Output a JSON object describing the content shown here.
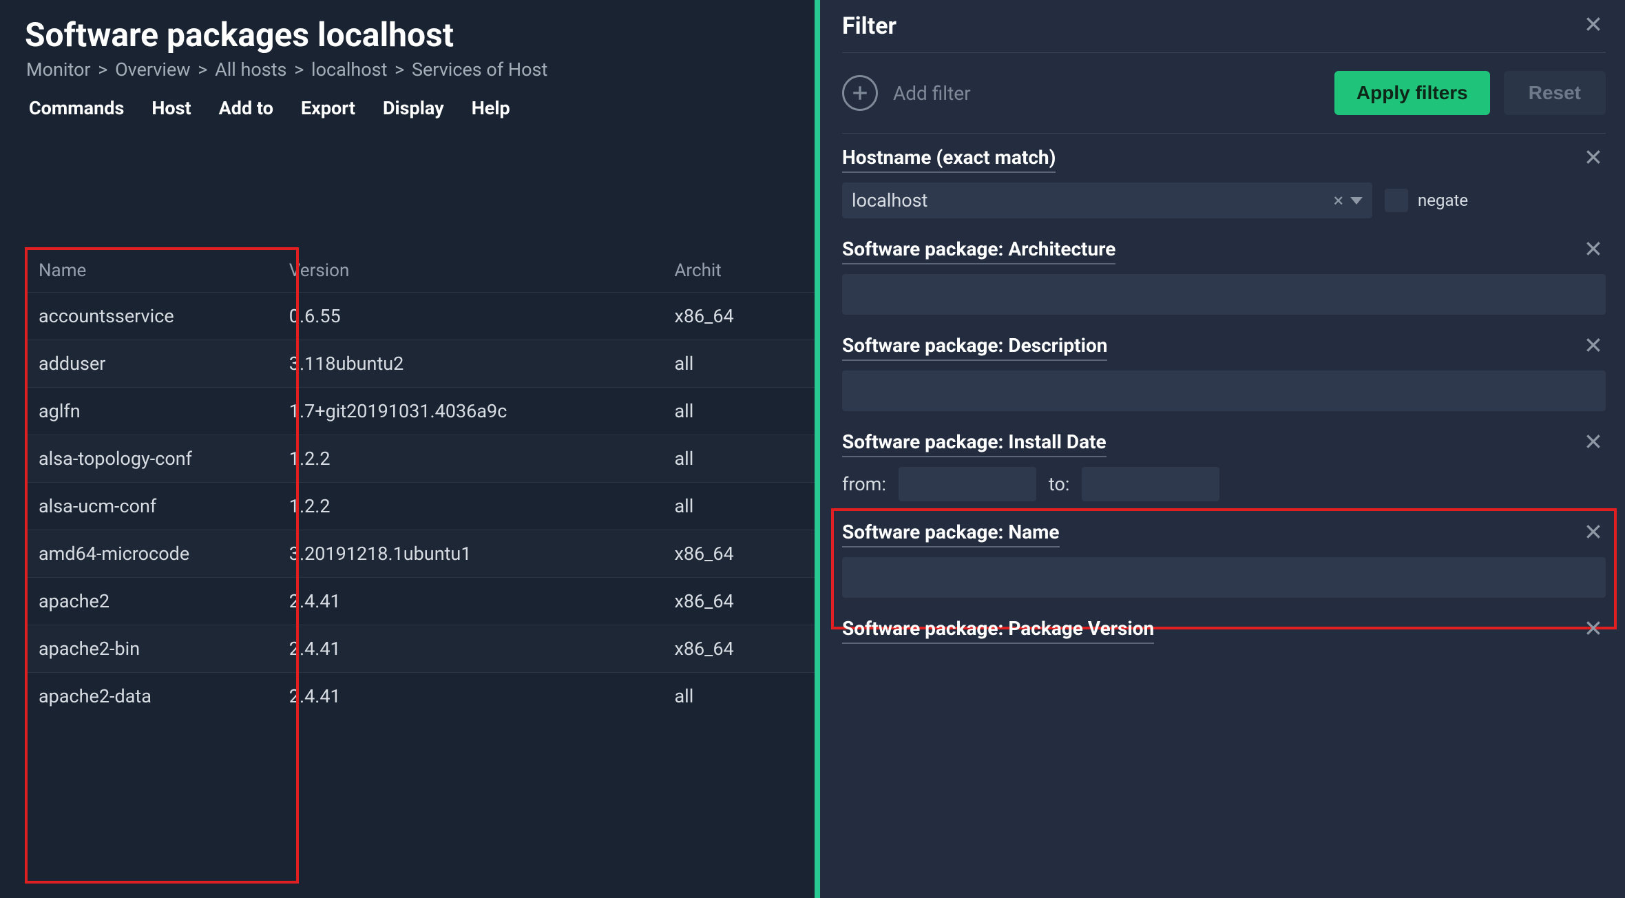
{
  "page_title": "Software packages localhost",
  "breadcrumb": {
    "items": [
      "Monitor",
      "Overview",
      "All hosts",
      "localhost",
      "Services of Host"
    ],
    "separator": ">"
  },
  "toolbar": {
    "commands": "Commands",
    "host": "Host",
    "add_to": "Add to",
    "export": "Export",
    "display": "Display",
    "help": "Help"
  },
  "table": {
    "headers": {
      "name": "Name",
      "version": "Version",
      "arch": "Archit"
    },
    "rows": [
      {
        "name": "accountsservice",
        "version": "0.6.55",
        "arch": "x86_64"
      },
      {
        "name": "adduser",
        "version": "3.118ubuntu2",
        "arch": "all"
      },
      {
        "name": "aglfn",
        "version": "1.7+git20191031.4036a9c",
        "arch": "all"
      },
      {
        "name": "alsa-topology-conf",
        "version": "1.2.2",
        "arch": "all"
      },
      {
        "name": "alsa-ucm-conf",
        "version": "1.2.2",
        "arch": "all"
      },
      {
        "name": "amd64-microcode",
        "version": "3.20191218.1ubuntu1",
        "arch": "x86_64"
      },
      {
        "name": "apache2",
        "version": "2.4.41",
        "arch": "x86_64"
      },
      {
        "name": "apache2-bin",
        "version": "2.4.41",
        "arch": "x86_64"
      },
      {
        "name": "apache2-data",
        "version": "2.4.41",
        "arch": "all"
      }
    ]
  },
  "filter": {
    "title": "Filter",
    "add_filter": "Add filter",
    "apply": "Apply filters",
    "reset": "Reset",
    "hostname": {
      "label": "Hostname (exact match)",
      "value": "localhost",
      "clear": "×",
      "negate": "negate"
    },
    "arch": {
      "label": "Software package: Architecture"
    },
    "desc": {
      "label": "Software package: Description"
    },
    "install_date": {
      "label": "Software package: Install Date",
      "from": "from:",
      "to": "to:"
    },
    "pkg_name": {
      "label": "Software package: Name"
    },
    "pkg_version": {
      "label": "Software package: Package Version"
    }
  }
}
